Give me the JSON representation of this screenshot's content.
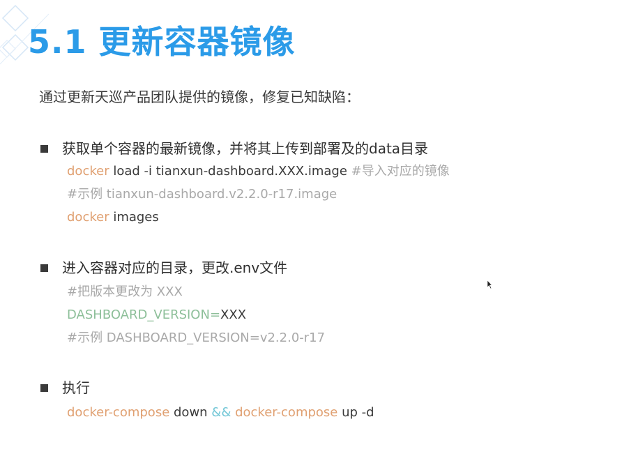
{
  "slide": {
    "title": "5.1 更新容器镜像",
    "intro": "通过更新天巡产品团队提供的镜像，修复已知缺陷："
  },
  "sections": [
    {
      "heading": "获取单个容器的最新镜像，并将其上传到部署及的data目录",
      "lines": [
        {
          "cmd": "docker",
          "rest": " load -i tianxun-dashboard.XXX.image",
          "comment": " #导入对应的镜像"
        },
        {
          "comment": "#示例 tianxun-dashboard.v2.2.0-r17.image"
        },
        {
          "cmd": "docker",
          "rest": " images"
        }
      ]
    },
    {
      "heading": "进入容器对应的目录，更改.env文件",
      "lines": [
        {
          "comment": "#把版本更改为 XXX"
        },
        {
          "var": "DASHBOARD_VERSION=",
          "value": "XXX"
        },
        {
          "comment": "#示例 DASHBOARD_VERSION=v2.2.0-r17"
        }
      ]
    },
    {
      "heading": "执行",
      "lines": [
        {
          "cmd1": "docker-compose",
          "arg1": " down ",
          "op": "&&",
          "cmd2": " docker-compose",
          "arg2": " up -d"
        }
      ]
    }
  ],
  "colors": {
    "title": "#2b9be8",
    "keyword": "#e0a071",
    "comment": "#a9a9a9",
    "variable": "#8dbf99",
    "operator": "#71c6d6"
  },
  "icons": {
    "decoration": "diamond-outline-decoration-icon",
    "cursor": "mouse-pointer-icon",
    "bullet": "square-bullet-icon"
  }
}
